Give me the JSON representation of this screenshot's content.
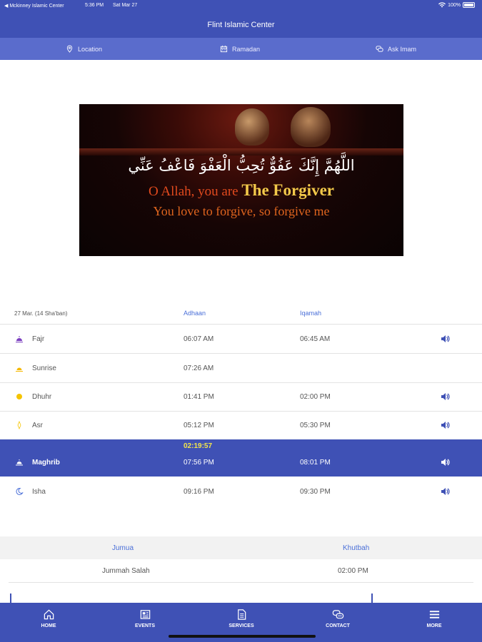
{
  "status_bar": {
    "back_label": "◀ Mckinney Islamic Center",
    "time": "5:36 PM",
    "date": "Sat Mar 27",
    "battery": "100%"
  },
  "header": {
    "title": "Flint Islamic Center"
  },
  "subnav": {
    "location": "Location",
    "ramadan": "Ramadan",
    "ask_imam": "Ask Imam"
  },
  "banner": {
    "arabic": "اللَّهُمَّ إِنَّكَ عَفُوٌّ تُحِبُّ الْعَفْوَ فَاعْفُ عَنِّي",
    "line1_prefix": "O Allah, you are ",
    "line1_emphasis": "The Forgiver",
    "line2": "You love to forgive, so forgive me"
  },
  "prayer_table": {
    "date": "27 Mar. (14 Sha'ban)",
    "col_adhaan": "Adhaan",
    "col_iqamah": "Iqamah",
    "countdown": "02:19:57",
    "rows": [
      {
        "name": "Fajr",
        "adhaan": "06:07 AM",
        "iqamah": "06:45 AM"
      },
      {
        "name": "Sunrise",
        "adhaan": "07:26 AM",
        "iqamah": ""
      },
      {
        "name": "Dhuhr",
        "adhaan": "01:41 PM",
        "iqamah": "02:00 PM"
      },
      {
        "name": "Asr",
        "adhaan": "05:12 PM",
        "iqamah": "05:30 PM"
      },
      {
        "name": "Maghrib",
        "adhaan": "07:56 PM",
        "iqamah": "08:01 PM"
      },
      {
        "name": "Isha",
        "adhaan": "09:16 PM",
        "iqamah": "09:30 PM"
      }
    ]
  },
  "jumua": {
    "col1": "Jumua",
    "col2": "Khutbah",
    "rows": [
      {
        "name": "Jummah Salah",
        "khutbah": "02:00 PM"
      }
    ]
  },
  "tabbar": {
    "home": "HOME",
    "events": "EVENTS",
    "services": "SERVICES",
    "contact": "CONTACT",
    "more": "MORE"
  },
  "colors": {
    "primary": "#3f51b5",
    "subnav": "#5a6ccc",
    "link": "#4a6fd8",
    "countdown": "#f3e54a"
  }
}
